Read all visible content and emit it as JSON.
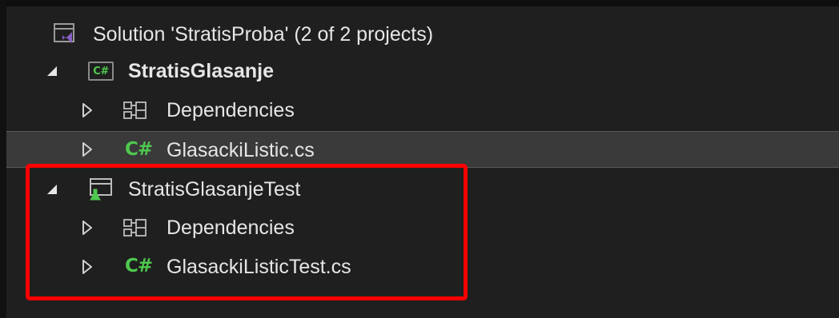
{
  "solution_explorer": {
    "solution": {
      "label": "Solution 'StratisProba' (2 of 2 projects)",
      "icon": "solution-icon"
    },
    "projects": [
      {
        "name": "StratisGlasanje",
        "icon": "csharp-project-icon",
        "expanded": true,
        "children": [
          {
            "label": "Dependencies",
            "icon": "dependencies-icon"
          },
          {
            "label": "GlasackiListic.cs",
            "icon": "csharp-file-icon",
            "selected": true
          }
        ]
      },
      {
        "name": "StratisGlasanjeTest",
        "icon": "test-project-icon",
        "expanded": true,
        "children": [
          {
            "label": "Dependencies",
            "icon": "dependencies-icon"
          },
          {
            "label": "GlasackiListicTest.cs",
            "icon": "csharp-file-icon"
          }
        ]
      }
    ],
    "csharp_glyph": "C#",
    "highlight_color": "#ff0000",
    "accent_green": "#4ec94e",
    "vs_purple": "#8661c5"
  }
}
